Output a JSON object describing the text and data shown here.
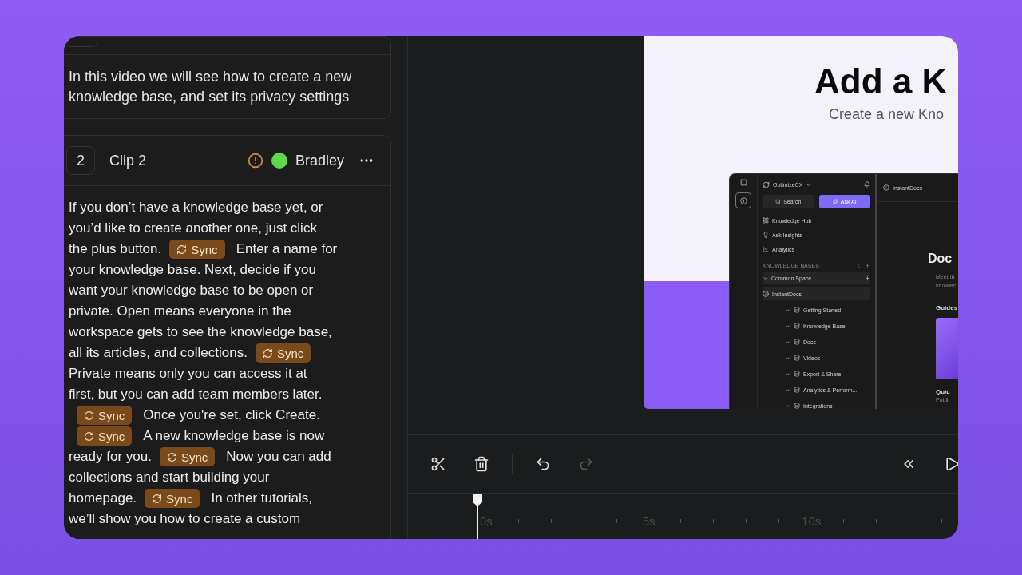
{
  "transcript": {
    "intro_text": "In this video we will see how to create a new knowledge base, and set its privacy settings",
    "clip": {
      "number": "2",
      "title": "Clip 2",
      "warning": true,
      "speaker": {
        "name": "Bradley",
        "color": "#5fd94a"
      },
      "lines": [
        [
          {
            "kind": "text",
            "text": "If you don’t have a knowledge base yet, or"
          }
        ],
        [
          {
            "kind": "text",
            "text": "you’d like to create another one, just click"
          }
        ],
        [
          {
            "kind": "text",
            "text": "the plus button."
          },
          {
            "kind": "sync",
            "text": "Sync"
          },
          {
            "kind": "text",
            "text": "Enter a name for"
          }
        ],
        [
          {
            "kind": "text",
            "text": "your knowledge base. Next, decide if you"
          }
        ],
        [
          {
            "kind": "text",
            "text": "want your knowledge base to be open or"
          }
        ],
        [
          {
            "kind": "text",
            "text": "private. Open means everyone in the"
          }
        ],
        [
          {
            "kind": "text",
            "text": "workspace gets to see the knowledge base,"
          }
        ],
        [
          {
            "kind": "text",
            "text": "all its articles, and collections."
          },
          {
            "kind": "sync",
            "text": "Sync"
          }
        ],
        [
          {
            "kind": "text",
            "text": "Private means only you can access it at"
          }
        ],
        [
          {
            "kind": "text",
            "text": "first, but you can add team members later."
          }
        ],
        [
          {
            "kind": "sync",
            "text": "Sync"
          },
          {
            "kind": "text",
            "text": "Once you're set, click Create."
          }
        ],
        [
          {
            "kind": "sync",
            "text": "Sync"
          },
          {
            "kind": "text",
            "text": "A new knowledge base is now"
          }
        ],
        [
          {
            "kind": "text",
            "text": "ready for you."
          },
          {
            "kind": "sync",
            "text": "Sync"
          },
          {
            "kind": "text",
            "text": "Now you can add"
          }
        ],
        [
          {
            "kind": "text",
            "text": "collections and start building your"
          }
        ],
        [
          {
            "kind": "text",
            "text": "homepage."
          },
          {
            "kind": "sync",
            "text": "Sync"
          },
          {
            "kind": "text",
            "text": "In other tutorials,"
          }
        ],
        [
          {
            "kind": "text",
            "text": "we’ll show you how to create a custom"
          }
        ]
      ]
    }
  },
  "slide": {
    "title": "Add a K",
    "subtitle": "Create a new Kno",
    "app": {
      "workspace": "OptimizeCX",
      "search": "Search",
      "ask_ai": "Ask AI",
      "nav": [
        {
          "kind": "hub",
          "label": "Knowledge Hub"
        },
        {
          "kind": "insights",
          "label": "Ask Insights"
        },
        {
          "kind": "analytics",
          "label": "Analytics"
        }
      ],
      "section": "KNOWLEDGE BASES",
      "tree": [
        {
          "label": "Common Space",
          "expanded": true,
          "children": [
            {
              "label": "InstantDocs",
              "children": [
                {
                  "label": "Getting Started"
                },
                {
                  "label": "Knowledge Base"
                },
                {
                  "label": "Docs"
                },
                {
                  "label": "Videos"
                },
                {
                  "label": "Export & Share"
                },
                {
                  "label": "Analytics & Perform..."
                },
                {
                  "label": "Integrations"
                }
              ]
            }
          ]
        }
      ],
      "breadcrumb": "InstantDocs",
      "heading": "Doc",
      "intro": [
        "Meet th",
        "knowlec"
      ],
      "guides": "Guides",
      "card_title": "Quic",
      "card_text": "Publi"
    }
  },
  "toolbar": {
    "tools": [
      {
        "kind": "cut",
        "disabled": false
      },
      {
        "kind": "delete",
        "disabled": false
      },
      {
        "kind": "undo",
        "disabled": false
      },
      {
        "kind": "redo",
        "disabled": true
      }
    ]
  },
  "timeline": {
    "labels": [
      "0s",
      "5s",
      "10s"
    ]
  }
}
